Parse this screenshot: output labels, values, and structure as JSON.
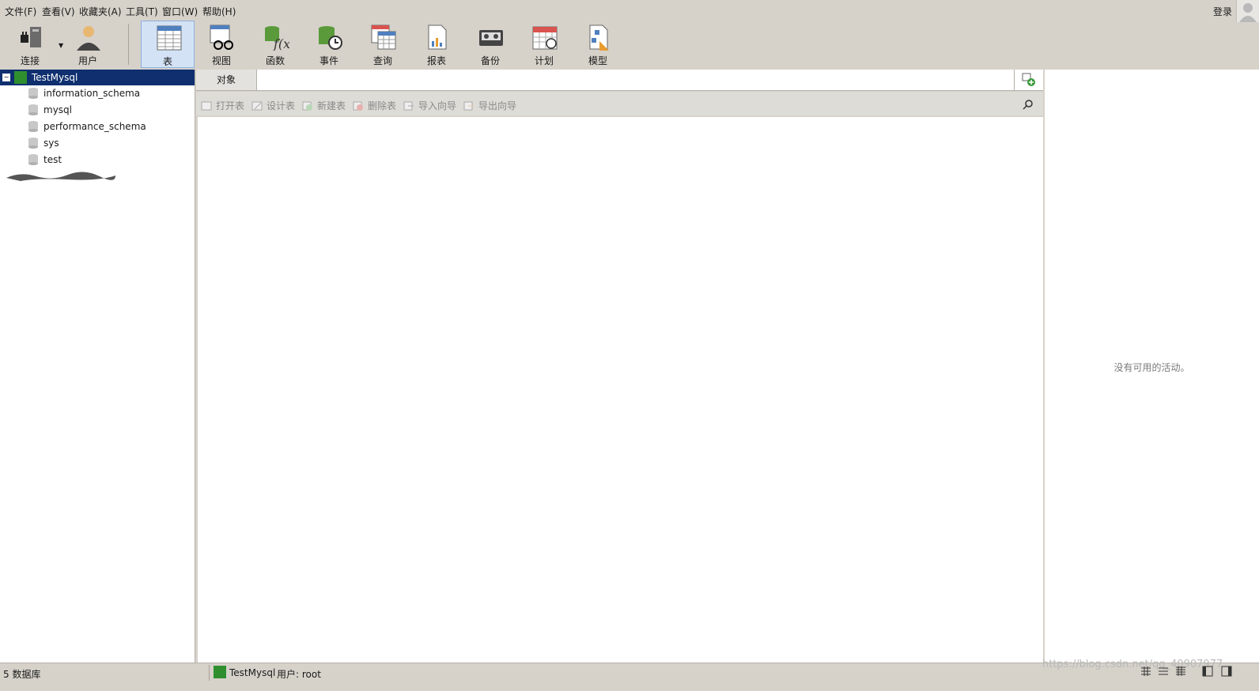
{
  "menu": [
    {
      "label": "文件(F)"
    },
    {
      "label": "查看(V)"
    },
    {
      "label": "收藏夹(A)"
    },
    {
      "label": "工具(T)"
    },
    {
      "label": "窗口(W)"
    },
    {
      "label": "帮助(H)"
    }
  ],
  "header": {
    "login_label": "登录"
  },
  "toolbar": {
    "items": [
      {
        "label": "连接",
        "icon": "plug-icon"
      },
      {
        "label": "用户",
        "icon": "user-icon"
      },
      {
        "label": "表",
        "icon": "table-icon",
        "active": true
      },
      {
        "label": "视图",
        "icon": "view-glasses-icon"
      },
      {
        "label": "函数",
        "icon": "function-icon"
      },
      {
        "label": "事件",
        "icon": "event-clock-icon"
      },
      {
        "label": "查询",
        "icon": "query-icon"
      },
      {
        "label": "报表",
        "icon": "report-icon"
      },
      {
        "label": "备份",
        "icon": "backup-icon"
      },
      {
        "label": "计划",
        "icon": "schedule-icon"
      },
      {
        "label": "模型",
        "icon": "model-icon"
      }
    ]
  },
  "tree": {
    "connection": "TestMysql",
    "databases": [
      "information_schema",
      "mysql",
      "performance_schema",
      "sys",
      "test"
    ]
  },
  "tabs": {
    "objects_label": "对象"
  },
  "object_toolbar": {
    "open_table": "打开表",
    "design_table": "设计表",
    "new_table": "新建表",
    "delete_table": "删除表",
    "import_wizard": "导入向导",
    "export_wizard": "导出向导"
  },
  "activity": {
    "empty_text": "没有可用的活动。"
  },
  "status": {
    "db_count": "5 数据库",
    "connection": "TestMysql",
    "user": "用户: root",
    "watermark": "https://blog.csdn.net/qq_40907977"
  },
  "colors": {
    "selection": "#0f2f6f",
    "active_tool": "#d3e2f5",
    "chrome": "#d6d2ca"
  }
}
